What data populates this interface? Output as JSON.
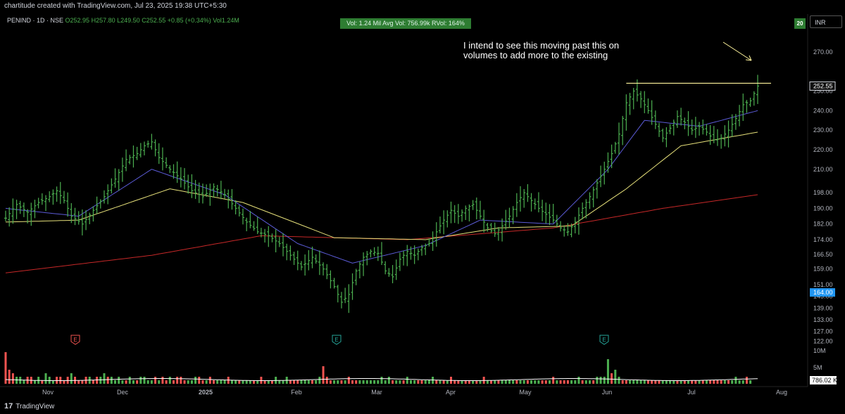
{
  "credit": "chartitude created with TradingView.com, Jul 23, 2025 19:38 UTC+5:30",
  "legend": {
    "symbol": "PENIND · 1D · NSE",
    "o": "O252.95",
    "h": "H257.80",
    "l": "L249.50",
    "c": "C252.55",
    "chg": "+0.85 (+0.34%)",
    "vol": "Vol1.24M"
  },
  "volume_box": "Vol: 1.24 Mil   Avg Vol: 756.99k   RVol: 164%",
  "badge": "20",
  "currency": "INR",
  "annotation": {
    "line1": "I intend to see this moving past this on",
    "line2": "volumes to add more to the existing"
  },
  "footer": {
    "logo": "17",
    "brand": "TradingView"
  },
  "colors": {
    "up": "#4caf50",
    "down": "#ef5350",
    "ma_short": "#5b5bd6",
    "ma_mid": "#e6e07a",
    "ma_long": "#c62828",
    "resistance": "#fff59d",
    "price_tag": "#d1d4dc",
    "rvol_tag": "#2196f3"
  },
  "chart_data": {
    "type": "ohlc",
    "price_axis": {
      "min": 133,
      "max": 275,
      "ticks": [
        270.0,
        250.0,
        240.0,
        230.0,
        220.0,
        210.0,
        198.0,
        190.0,
        182.0,
        174.0,
        166.5,
        159.0,
        151.0,
        145.0,
        139.0,
        133.0,
        127.0,
        122.0
      ]
    },
    "time_labels": [
      "Nov",
      "Dec",
      "2025",
      "Feb",
      "Mar",
      "Apr",
      "May",
      "Jun",
      "Jul",
      "Aug"
    ],
    "last_price": 252.55,
    "rvol_value": "164.00",
    "resistance_level": 254,
    "volume_axis": [
      "10M",
      "5M"
    ],
    "last_volume": "786.02 K",
    "earnings_marks": [
      "E",
      "E",
      "E"
    ],
    "price_path": [
      [
        0,
        185
      ],
      [
        3,
        192
      ],
      [
        6,
        188
      ],
      [
        9,
        193
      ],
      [
        12,
        196
      ],
      [
        14,
        199
      ],
      [
        16,
        194
      ],
      [
        18,
        186
      ],
      [
        21,
        182
      ],
      [
        24,
        189
      ],
      [
        27,
        196
      ],
      [
        30,
        205
      ],
      [
        33,
        215
      ],
      [
        36,
        218
      ],
      [
        38,
        222
      ],
      [
        40,
        224
      ],
      [
        42,
        216
      ],
      [
        45,
        210
      ],
      [
        48,
        205
      ],
      [
        51,
        199
      ],
      [
        54,
        196
      ],
      [
        57,
        201
      ],
      [
        60,
        197
      ],
      [
        63,
        190
      ],
      [
        66,
        183
      ],
      [
        69,
        178
      ],
      [
        72,
        176
      ],
      [
        75,
        172
      ],
      [
        78,
        166
      ],
      [
        81,
        160
      ],
      [
        84,
        165
      ],
      [
        87,
        159
      ],
      [
        90,
        150
      ],
      [
        92,
        142
      ],
      [
        94,
        146
      ],
      [
        96,
        158
      ],
      [
        98,
        165
      ],
      [
        100,
        168
      ],
      [
        102,
        167
      ],
      [
        104,
        158
      ],
      [
        106,
        155
      ],
      [
        108,
        164
      ],
      [
        110,
        168
      ],
      [
        112,
        166
      ],
      [
        114,
        170
      ],
      [
        116,
        172
      ],
      [
        118,
        178
      ],
      [
        120,
        184
      ],
      [
        122,
        189
      ],
      [
        124,
        186
      ],
      [
        126,
        190
      ],
      [
        128,
        192
      ],
      [
        130,
        186
      ],
      [
        132,
        180
      ],
      [
        134,
        177
      ],
      [
        136,
        181
      ],
      [
        138,
        186
      ],
      [
        140,
        193
      ],
      [
        142,
        198
      ],
      [
        144,
        194
      ],
      [
        146,
        190
      ],
      [
        148,
        187
      ],
      [
        150,
        184
      ],
      [
        152,
        180
      ],
      [
        154,
        178
      ],
      [
        156,
        183
      ],
      [
        158,
        190
      ],
      [
        160,
        196
      ],
      [
        162,
        203
      ],
      [
        164,
        210
      ],
      [
        166,
        218
      ],
      [
        168,
        228
      ],
      [
        170,
        244
      ],
      [
        172,
        250
      ],
      [
        174,
        246
      ],
      [
        176,
        240
      ],
      [
        178,
        233
      ],
      [
        180,
        226
      ],
      [
        182,
        231
      ],
      [
        184,
        237
      ],
      [
        186,
        234
      ],
      [
        188,
        230
      ],
      [
        190,
        232
      ],
      [
        192,
        229
      ],
      [
        194,
        225
      ],
      [
        196,
        226
      ],
      [
        198,
        230
      ],
      [
        200,
        236
      ],
      [
        202,
        243
      ],
      [
        204,
        245
      ],
      [
        206,
        252.55
      ]
    ],
    "ma_short": [
      [
        0,
        190
      ],
      [
        20,
        186
      ],
      [
        40,
        210
      ],
      [
        60,
        197
      ],
      [
        80,
        172
      ],
      [
        95,
        162
      ],
      [
        115,
        171
      ],
      [
        130,
        184
      ],
      [
        150,
        182
      ],
      [
        165,
        210
      ],
      [
        175,
        235
      ],
      [
        190,
        232
      ],
      [
        206,
        240
      ]
    ],
    "ma_mid": [
      [
        0,
        183
      ],
      [
        20,
        184
      ],
      [
        45,
        200
      ],
      [
        65,
        193
      ],
      [
        90,
        175
      ],
      [
        115,
        174
      ],
      [
        135,
        180
      ],
      [
        155,
        181
      ],
      [
        170,
        200
      ],
      [
        185,
        222
      ],
      [
        206,
        229
      ]
    ],
    "ma_long": [
      [
        0,
        157
      ],
      [
        40,
        166
      ],
      [
        70,
        176
      ],
      [
        110,
        174
      ],
      [
        150,
        180
      ],
      [
        180,
        190
      ],
      [
        206,
        197
      ]
    ],
    "volume_bars": [
      9,
      4,
      3,
      2,
      2,
      1,
      2,
      2,
      1,
      2,
      1,
      3,
      2,
      1,
      2,
      2,
      1,
      2,
      3,
      2,
      1,
      1,
      2,
      2,
      1,
      2,
      2,
      3,
      2,
      2,
      1,
      2,
      1,
      1,
      2,
      1,
      1,
      2,
      2,
      1,
      1,
      2,
      1,
      2,
      1,
      2,
      1,
      2,
      2,
      1,
      1,
      1,
      2,
      2,
      1,
      1,
      2,
      1,
      1,
      1,
      1,
      2,
      1,
      1,
      1,
      1,
      1,
      1,
      1,
      1,
      2,
      1,
      1,
      1,
      2,
      1,
      1,
      2,
      1,
      1,
      1,
      1,
      1,
      1,
      1,
      1,
      2,
      5,
      2,
      1,
      1,
      1,
      1,
      1,
      2,
      1,
      1,
      1,
      1,
      1,
      1,
      1,
      1,
      2,
      1,
      2,
      1,
      1,
      1,
      1,
      2,
      1,
      1,
      1,
      1,
      1,
      1,
      2,
      1,
      1,
      1,
      1,
      2,
      1,
      1,
      1,
      1,
      1,
      1,
      1,
      1,
      2,
      1,
      1,
      1,
      1,
      1,
      1,
      1,
      1,
      1,
      1,
      1,
      1,
      1,
      1,
      1,
      1,
      1,
      1,
      2,
      1,
      1,
      1,
      1,
      1,
      1,
      2,
      1,
      1,
      1,
      1,
      2,
      2,
      2,
      7,
      3,
      4,
      2,
      1,
      1,
      1,
      1,
      1,
      1,
      1,
      1,
      1,
      1,
      1,
      1,
      1,
      1,
      1,
      1,
      1,
      1,
      1,
      1,
      1,
      1,
      1,
      1,
      1,
      1,
      1,
      1,
      1,
      1,
      1,
      2,
      1,
      1,
      2,
      1
    ]
  }
}
